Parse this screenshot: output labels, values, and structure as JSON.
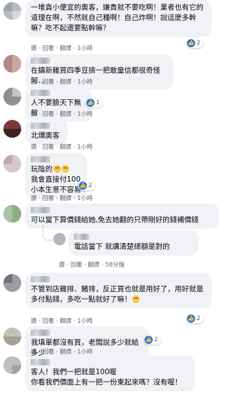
{
  "comments": [
    {
      "text": "一堆貪小便宜的奧客，嫌貴就不要吃啊！業者也有它的道理在啊，不然就自己種啊！自己炸啊！說這麼多幹嘛？吃不起還要點幹嘛？",
      "reactions": "2"
    },
    {
      "text": "在鎮新雞買四季豆擠一把敢童信都很奇怪阿..."
    },
    {
      "text": "人不要臉天下無敵",
      "reactions": "1"
    },
    {
      "text": "北爛奧客"
    },
    {
      "text_lines": [
        "玩陰的",
        "我會直接付100",
        "小本生意不容易"
      ],
      "reactions": "2"
    },
    {
      "text": "可以當下算價錢給她,免去她翻的只帶剛好的錢補價錢"
    },
    {
      "text": "電話當下 就講清楚總額是對的",
      "time": "58分鐘"
    },
    {
      "text": "不管到店雞排、豬排，反正買也就是用好了，用好就是多付點錢，多吃一點就好了嘛！",
      "reactions": "2"
    },
    {
      "text": "我填單都沒有買，老闆說多少就給多少",
      "reactions": "2"
    },
    {
      "text": "客人！我們一把就是100喔\n你看我們價面上有一把一份東起來嗎？沒有喔！"
    }
  ],
  "actions": {
    "like": "讚",
    "reply": "回覆",
    "translate": "翻譯",
    "time_default": "1小時"
  }
}
